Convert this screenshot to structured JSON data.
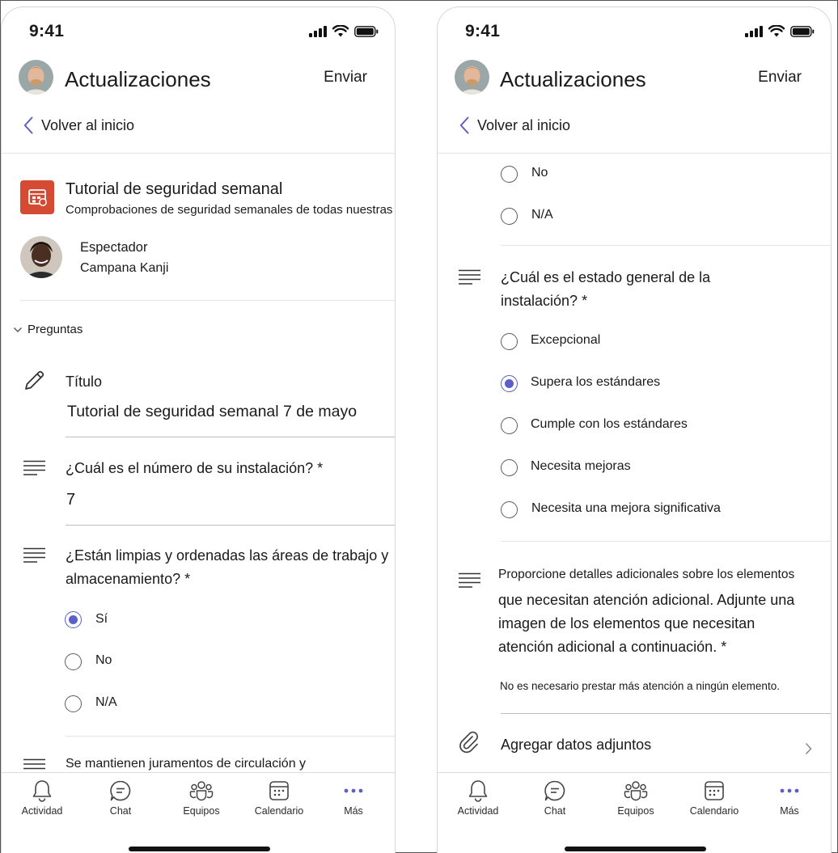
{
  "status": {
    "time": "9:41"
  },
  "header": {
    "title": "Actualizaciones",
    "send_label": "Enviar"
  },
  "back": {
    "label": "Volver al inicio"
  },
  "form": {
    "title": "Tutorial de seguridad semanal",
    "subtitle": "Comprobaciones de seguridad semanales de todas nuestras instalaciones",
    "role": "Espectador",
    "person": "Campana Kanji",
    "section": "Preguntas",
    "title_field_label": "Título",
    "title_field_value": "Tutorial de seguridad semanal 7 de mayo",
    "q_facility_number": "¿Cuál es el número de su instalación? *",
    "q_facility_number_answer": "7",
    "q_clean": {
      "question_line1": "¿Están limpias y ordenadas las áreas de trabajo y",
      "question_line2": "almacenamiento? *",
      "options": [
        "Sí",
        "No",
        "N/A"
      ],
      "selected": "Sí"
    },
    "q_next_partial": "Se mantienen juramentos de circulación y"
  },
  "right": {
    "prev_options": [
      "No",
      "N/A"
    ],
    "q_overall": {
      "question_line1": "¿Cuál es el estado general de la",
      "question_line2": "instalación? *",
      "options": [
        "Excepcional",
        "Supera los estándares",
        "Cumple con los estándares",
        "Necesita mejoras",
        "Necesita una mejora significativa"
      ],
      "selected": "Supera los estándares"
    },
    "q_details": {
      "line1": "Proporcione detalles adicionales sobre los elementos",
      "line2": "que necesitan atención adicional. Adjunte una",
      "line3": "imagen de los elementos que necesitan",
      "line4": "atención adicional a continuación. *",
      "answer": "No es necesario prestar más atención a ningún elemento."
    },
    "attach_label": "Agregar datos adjuntos"
  },
  "nav": {
    "items": [
      "Actividad",
      "Chat",
      "Equipos",
      "Calendario",
      "Más"
    ]
  },
  "colors": {
    "accent": "#5b5fc7",
    "form_icon": "#d44a33"
  }
}
